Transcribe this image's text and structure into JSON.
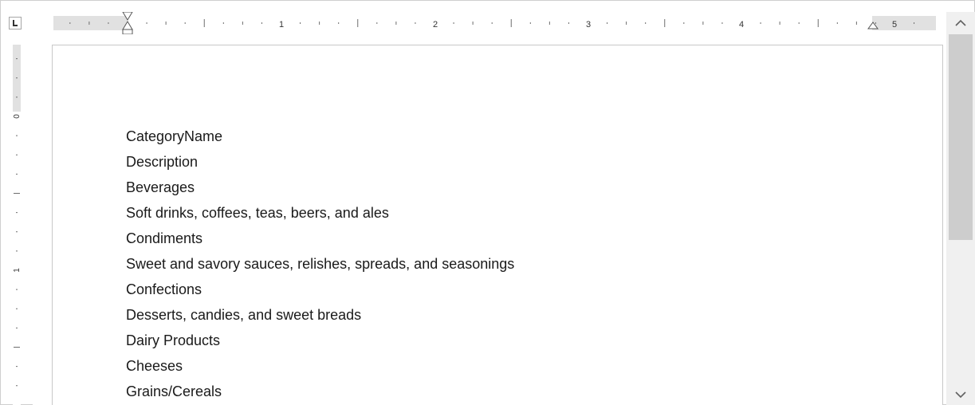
{
  "ruler": {
    "horizontal_labels": [
      "1",
      "2",
      "3",
      "4",
      "5"
    ],
    "vertical_labels": [
      "0",
      "1"
    ]
  },
  "document": {
    "lines": [
      "CategoryName",
      "Description",
      "Beverages",
      "Soft drinks, coffees, teas, beers, and ales",
      "Condiments",
      "Sweet and savory sauces, relishes, spreads, and seasonings",
      "Confections",
      "Desserts, candies, and sweet breads",
      "Dairy Products",
      "Cheeses",
      "Grains/Cereals"
    ]
  },
  "icons": {
    "tab_selector": "tab-stop-left-icon",
    "scroll_up": "chevron-up-icon",
    "scroll_down": "chevron-down-icon",
    "first_line_indent": "first-line-indent-marker-icon",
    "hanging_indent": "hanging-indent-marker-icon",
    "right_indent": "right-indent-marker-icon"
  }
}
